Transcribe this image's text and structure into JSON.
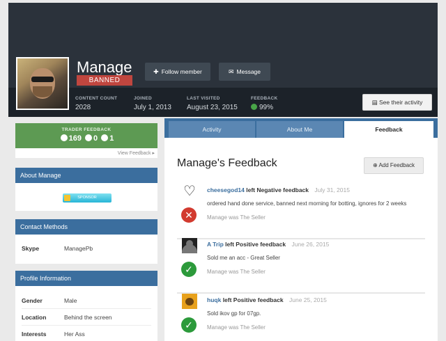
{
  "profile": {
    "name": "Manage",
    "badge": "BANNED",
    "follow_label": "Follow member",
    "message_label": "Message",
    "activity_label": "See their activity",
    "stats": [
      {
        "label": "CONTENT COUNT",
        "value": "2028"
      },
      {
        "label": "JOINED",
        "value": "July 1, 2013"
      },
      {
        "label": "LAST VISITED",
        "value": "August 23, 2015"
      },
      {
        "label": "FEEDBACK",
        "value": "99%"
      }
    ]
  },
  "sidebar": {
    "trader": {
      "title": "TRADER FEEDBACK",
      "positive": "169",
      "neutral": "0",
      "negative": "1",
      "view_link": "View Feedback ▸"
    },
    "about": {
      "title": "About Manage",
      "sponsor_label": "SPONSOR"
    },
    "contact": {
      "title": "Contact Methods",
      "rows": [
        {
          "key": "Skype",
          "value": "ManagePb"
        }
      ]
    },
    "profile_info": {
      "title": "Profile Information",
      "rows": [
        {
          "key": "Gender",
          "value": "Male"
        },
        {
          "key": "Location",
          "value": "Behind the screen"
        },
        {
          "key": "Interests",
          "value": "Her Ass"
        }
      ]
    }
  },
  "tabs": [
    {
      "label": "Activity",
      "active": false
    },
    {
      "label": "About Me",
      "active": false
    },
    {
      "label": "Feedback",
      "active": true
    }
  ],
  "feedback": {
    "title": "Manage's Feedback",
    "add_label": "Add Feedback",
    "items": [
      {
        "user": "cheesegod14",
        "kind": "left Negative feedback",
        "date": "July 31, 2015",
        "comment": "ordered hand done service, banned next morning for botting, ignores for 2 weeks",
        "role": "Manage was The Seller",
        "verdict_icon": "cross-circle-icon",
        "verdict_symbol": "✕"
      },
      {
        "user": "A Trip",
        "kind": "left Positive feedback",
        "date": "June 26, 2015",
        "comment": "Sold me an acc - Great Seller",
        "role": "Manage was The Seller",
        "verdict_icon": "check-circle-icon",
        "verdict_symbol": "✓"
      },
      {
        "user": "huqk",
        "kind": "left Positive feedback",
        "date": "June 25, 2015",
        "comment": "Sold ikov gp for 07gp.",
        "role": "Manage was The Seller",
        "verdict_icon": "check-circle-icon",
        "verdict_symbol": "✓"
      }
    ]
  },
  "colors": {
    "hero": "#2b323b",
    "accent_blue": "#3b6e9e",
    "banned": "#c0463f",
    "trader_green": "#5d9a53",
    "negative": "#d23a2f",
    "positive": "#2c9a3b"
  }
}
